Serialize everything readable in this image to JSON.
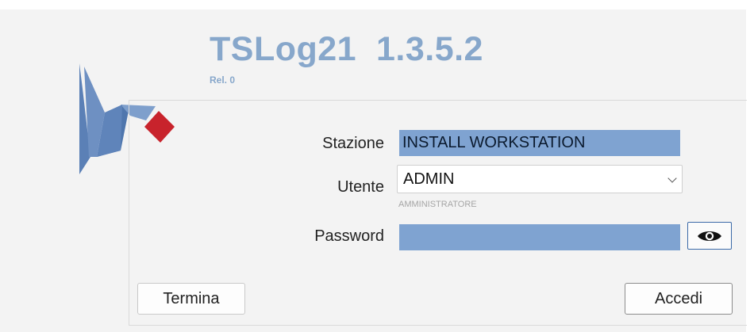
{
  "header": {
    "app_title": "TSLog21  1.3.5.2",
    "release": "Rel. 0"
  },
  "colors": {
    "accent_blue": "#7fa3d1",
    "title_blue": "#87a7cb",
    "logo_blue": "#5b80b6",
    "logo_red": "#c8232c"
  },
  "form": {
    "stazione_label": "Stazione",
    "stazione_value": "INSTALL WORKSTATION",
    "utente_label": "Utente",
    "utente_value": "ADMIN",
    "utente_role": "AMMINISTRATORE",
    "password_label": "Password",
    "password_value": "",
    "show_password_icon": "eye-icon"
  },
  "buttons": {
    "termina_label": "Termina",
    "accedi_label": "Accedi"
  }
}
